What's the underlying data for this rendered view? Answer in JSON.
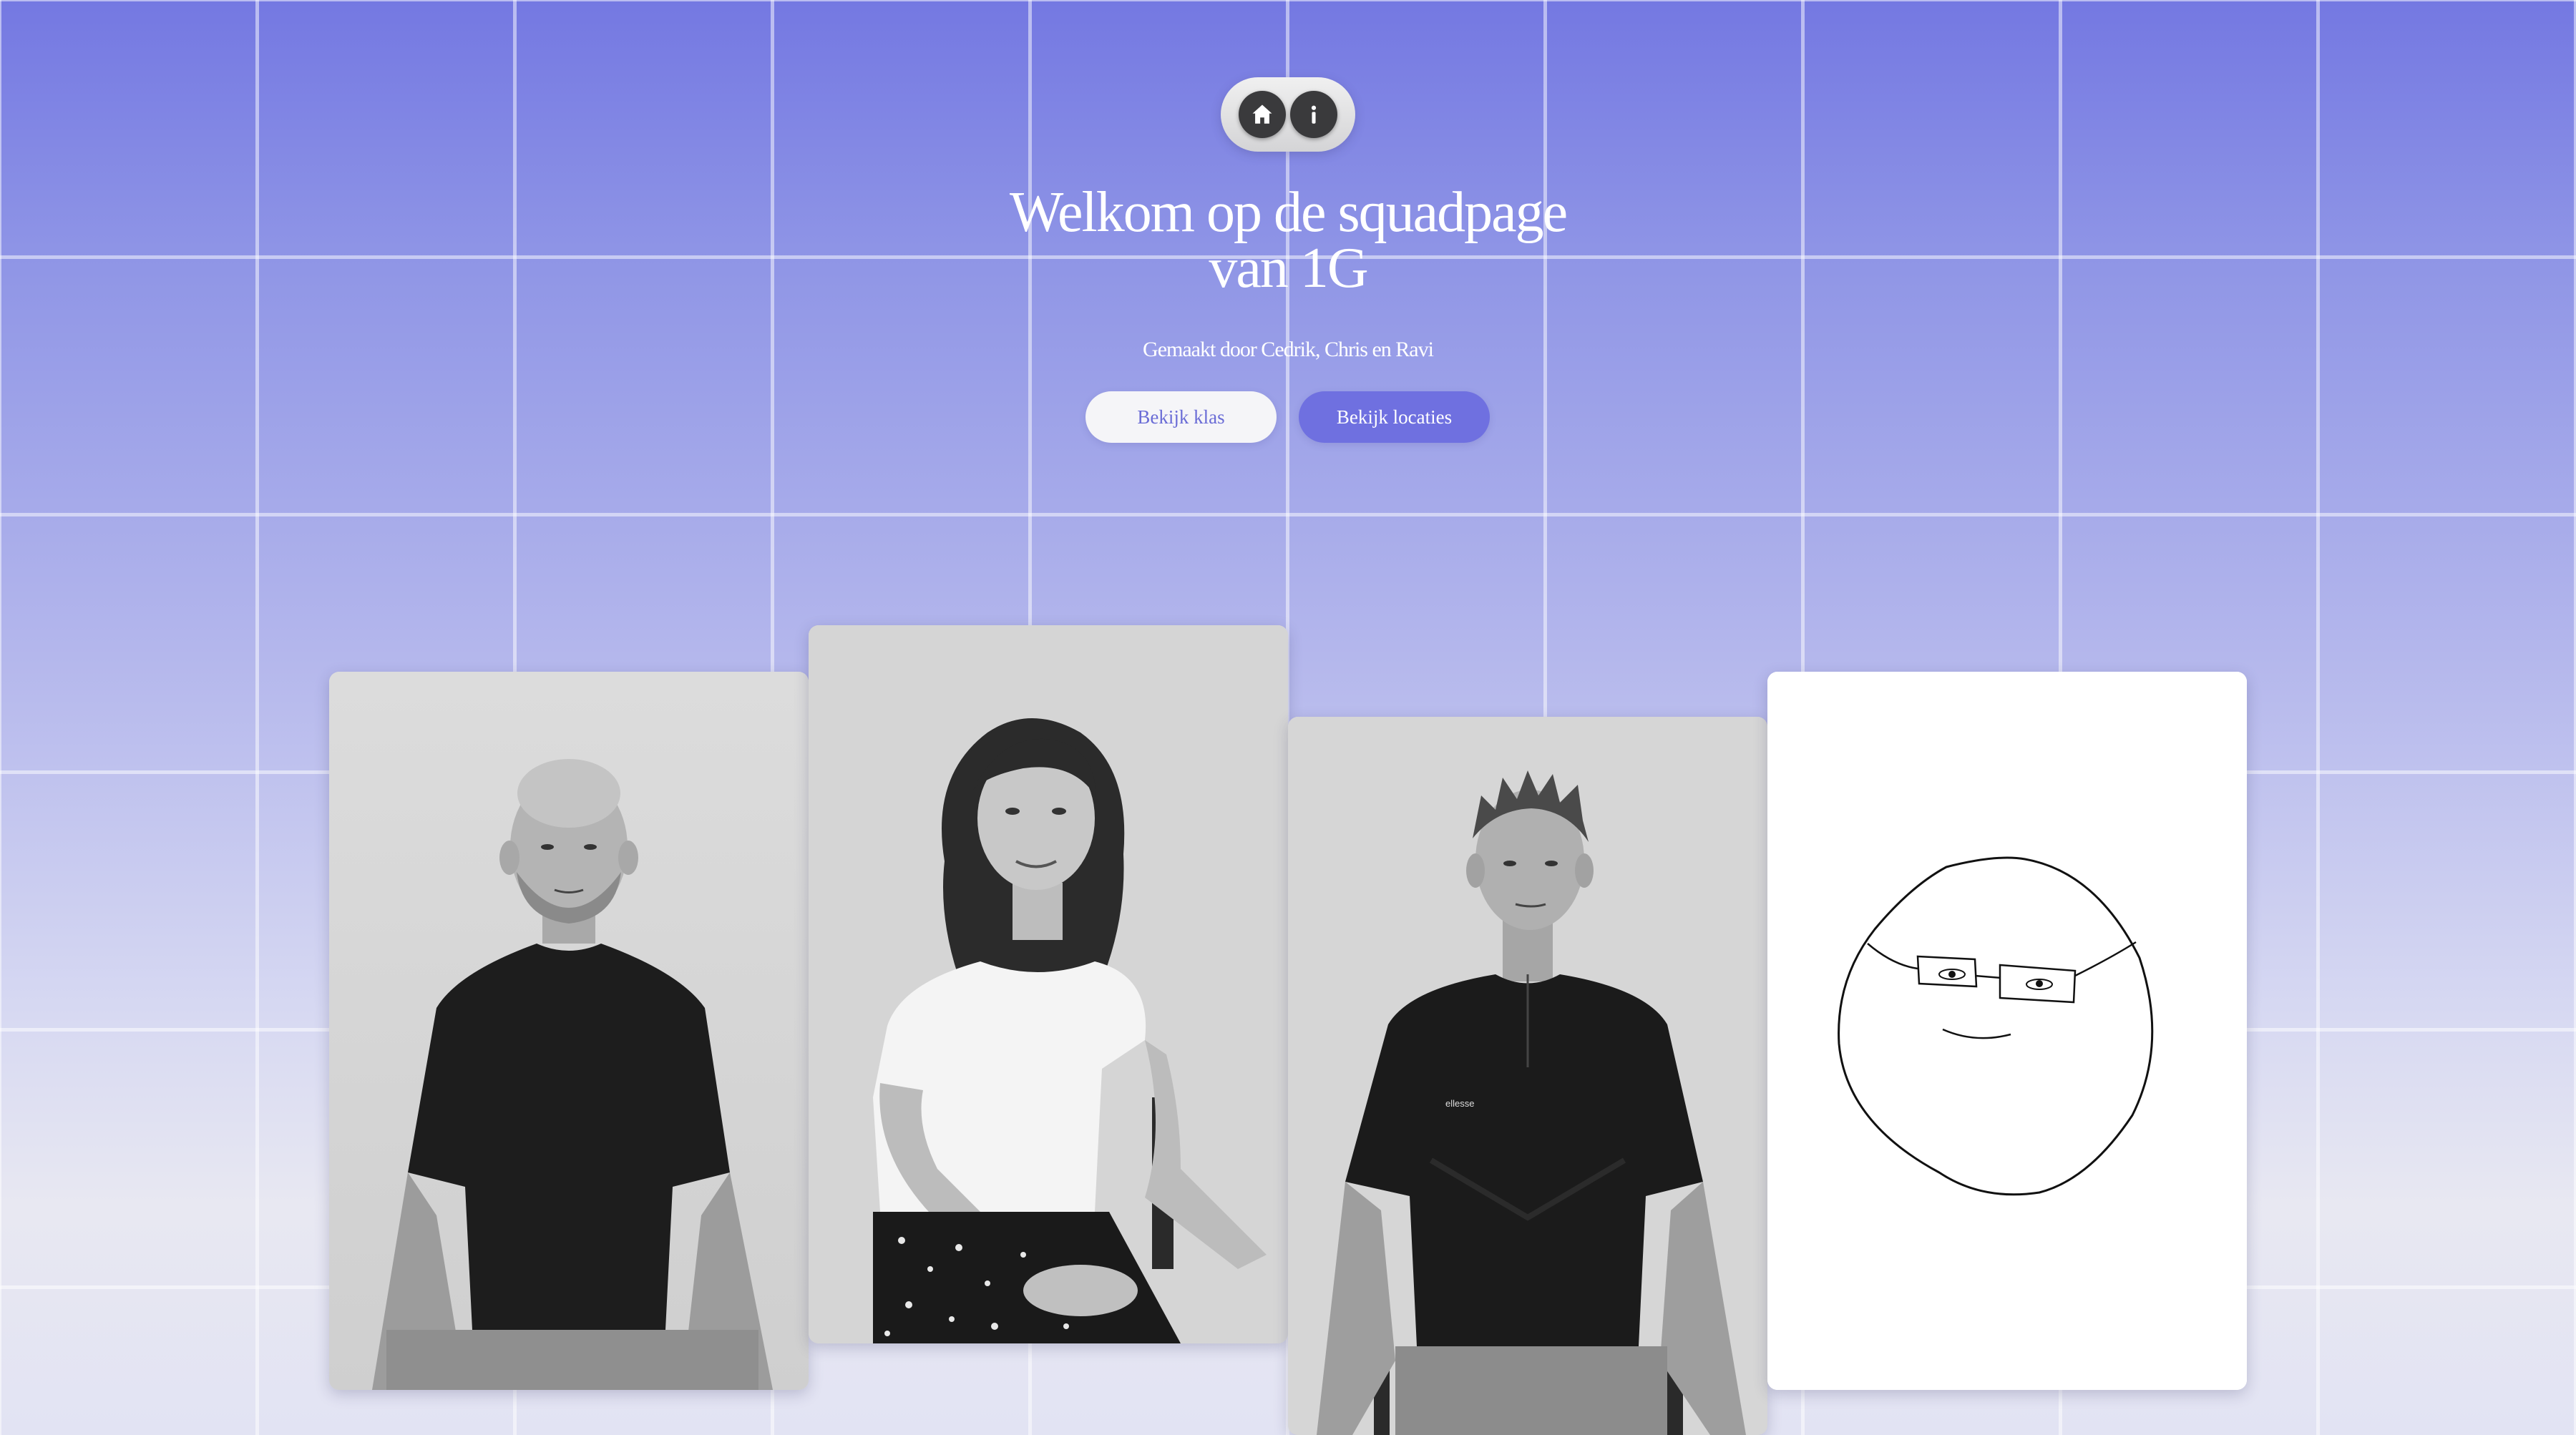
{
  "nav": {
    "items": [
      {
        "icon": "home-icon"
      },
      {
        "icon": "info-icon"
      }
    ]
  },
  "hero": {
    "title_line1": "Welkom op de squadpage",
    "title_line2": "van 1G",
    "subtitle": "Gemaakt door Cedrik, Chris en Ravi",
    "primary_button": "Bekijk klas",
    "secondary_button": "Bekijk locaties"
  },
  "photos": [
    {
      "kind": "photo"
    },
    {
      "kind": "photo"
    },
    {
      "kind": "photo"
    },
    {
      "kind": "drawing"
    }
  ],
  "colors": {
    "accent": "#6f70e0",
    "background_top": "#7478e2",
    "background_bottom": "#e2e3f3",
    "nav_button": "#3a3a3c"
  }
}
